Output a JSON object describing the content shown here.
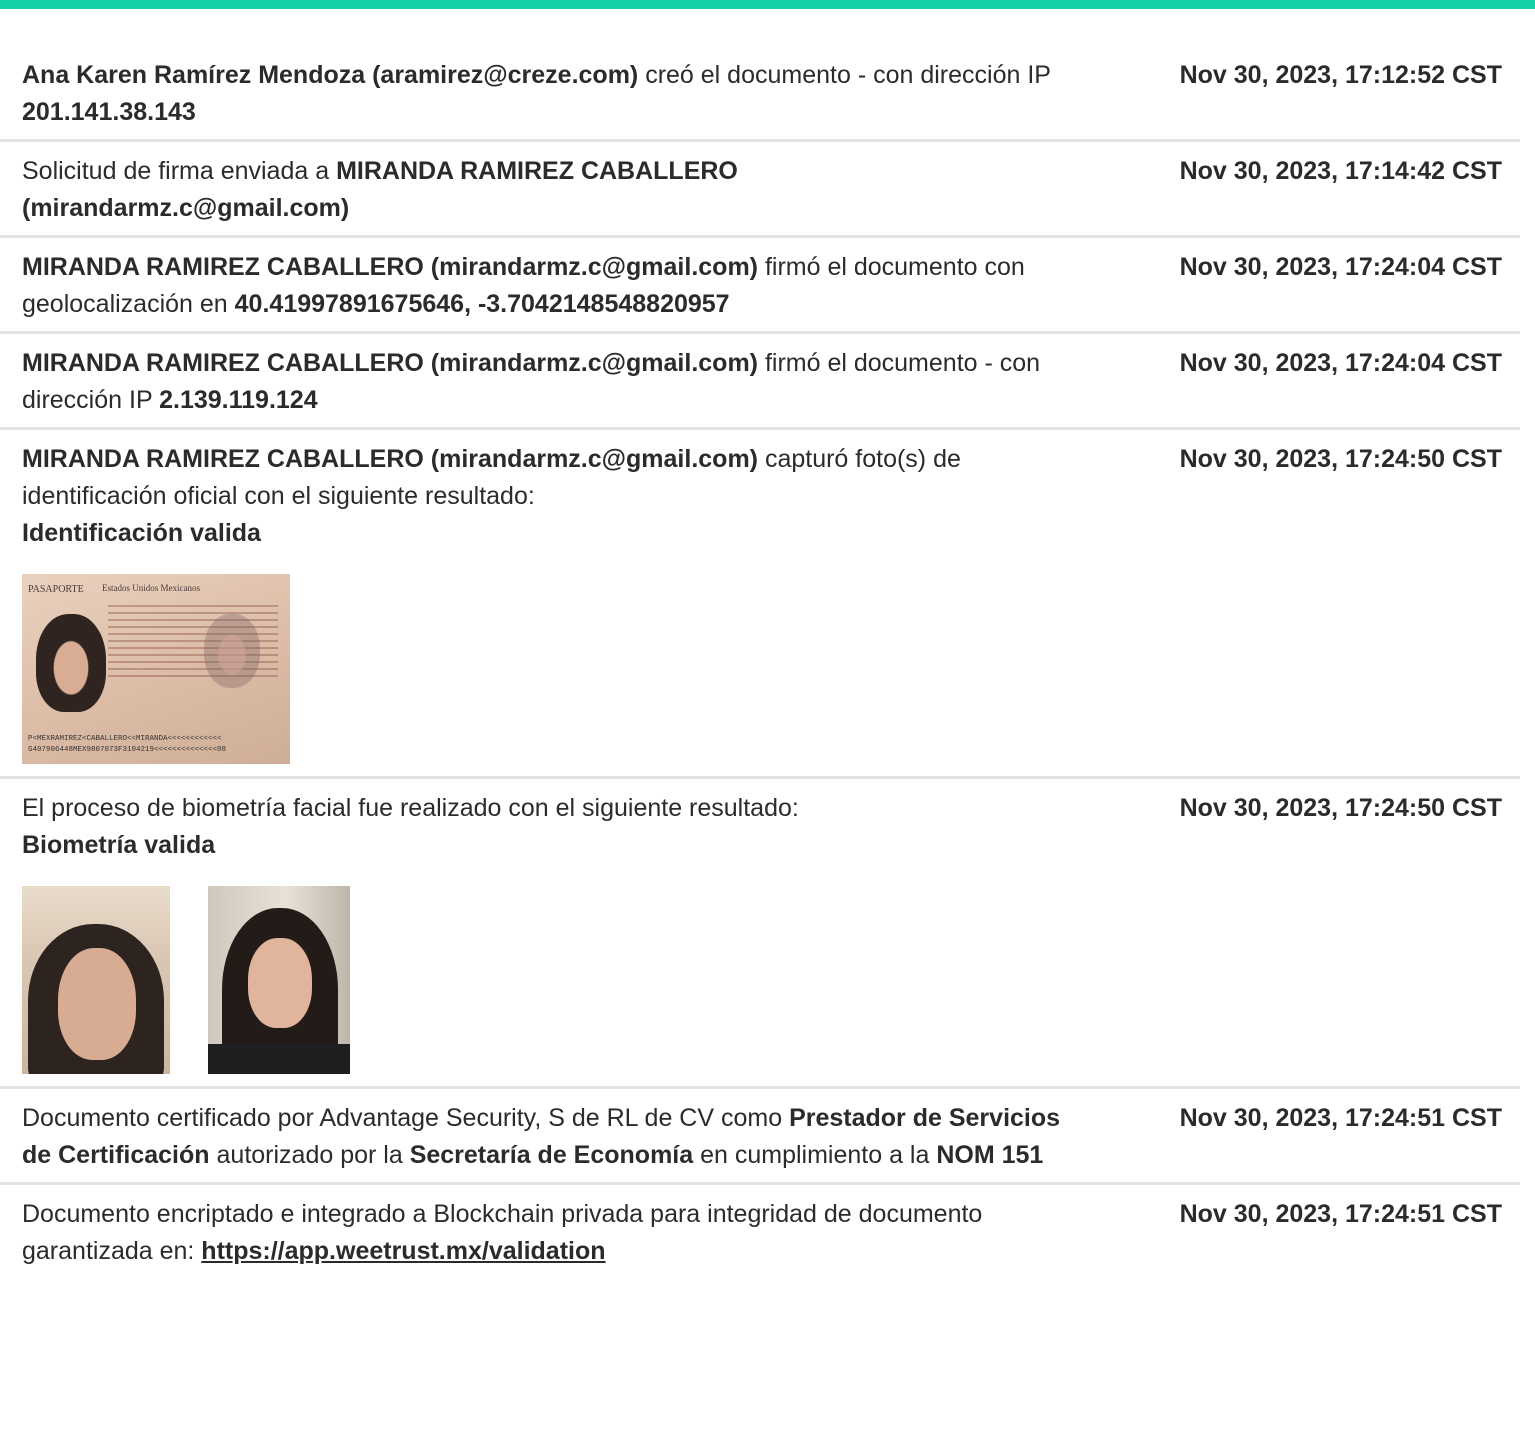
{
  "accent_color": "#12d1a6",
  "entries": [
    {
      "timestamp": "Nov 30, 2023, 17:12:52 CST",
      "parts": [
        {
          "t": "Ana Karen Ramírez Mendoza (aramirez@creze.com)",
          "b": true
        },
        {
          "t": " creó el documento - con dirección IP "
        },
        {
          "t": "201.141.38.143",
          "b": true
        }
      ]
    },
    {
      "timestamp": "Nov 30, 2023, 17:14:42 CST",
      "parts": [
        {
          "t": "Solicitud de firma enviada a "
        },
        {
          "t": "MIRANDA RAMIREZ CABALLERO (mirandarmz.c@gmail.com)",
          "b": true
        }
      ]
    },
    {
      "timestamp": "Nov 30, 2023, 17:24:04 CST",
      "parts": [
        {
          "t": "MIRANDA RAMIREZ CABALLERO (mirandarmz.c@gmail.com)",
          "b": true
        },
        {
          "t": " firmó el documento con geolocalización en "
        },
        {
          "t": "40.41997891675646, -3.7042148548820957",
          "b": true
        }
      ]
    },
    {
      "timestamp": "Nov 30, 2023, 17:24:04 CST",
      "parts": [
        {
          "t": "MIRANDA RAMIREZ CABALLERO (mirandarmz.c@gmail.com)",
          "b": true
        },
        {
          "t": " firmó el documento - con dirección IP "
        },
        {
          "t": "2.139.119.124",
          "b": true
        }
      ]
    },
    {
      "timestamp": "Nov 30, 2023, 17:24:50 CST",
      "parts": [
        {
          "t": "MIRANDA RAMIREZ CABALLERO (mirandarmz.c@gmail.com)",
          "b": true
        },
        {
          "t": " capturó foto(s) de identificación oficial con el siguiente resultado:"
        },
        {
          "br": true
        },
        {
          "t": "Identificación valida",
          "b": true
        }
      ],
      "photos": [
        "passport"
      ]
    },
    {
      "timestamp": "Nov 30, 2023, 17:24:50 CST",
      "parts": [
        {
          "t": "El proceso de biometría facial fue realizado con el siguiente resultado:"
        },
        {
          "br": true
        },
        {
          "t": "Biometría valida",
          "b": true
        }
      ],
      "photos": [
        "face-crop",
        "selfie"
      ]
    },
    {
      "timestamp": "Nov 30, 2023, 17:24:51 CST",
      "parts": [
        {
          "t": "Documento certificado por Advantage Security, S de RL de CV como "
        },
        {
          "t": "Prestador de Servicios de Certificación",
          "b": true
        },
        {
          "t": " autorizado por la "
        },
        {
          "t": "Secretaría de Economía",
          "b": true
        },
        {
          "t": " en cumplimiento a la "
        },
        {
          "t": "NOM 151",
          "b": true
        }
      ]
    },
    {
      "timestamp": "Nov 30, 2023, 17:24:51 CST",
      "parts": [
        {
          "t": "Documento encriptado e integrado a Blockchain privada para integridad de documento garantizada en: "
        },
        {
          "t": "https://app.weetrust.mx/validation",
          "link": true
        }
      ]
    }
  ],
  "passport": {
    "title": "PASAPORTE",
    "header": "Estados Unidos Mexicanos",
    "mrz_line1": "P<MEXRAMIREZ<CABALLERO<<MIRANDA<<<<<<<<<<<<",
    "mrz_line2": "G407906448MEX9807073F3104219<<<<<<<<<<<<<<08"
  }
}
